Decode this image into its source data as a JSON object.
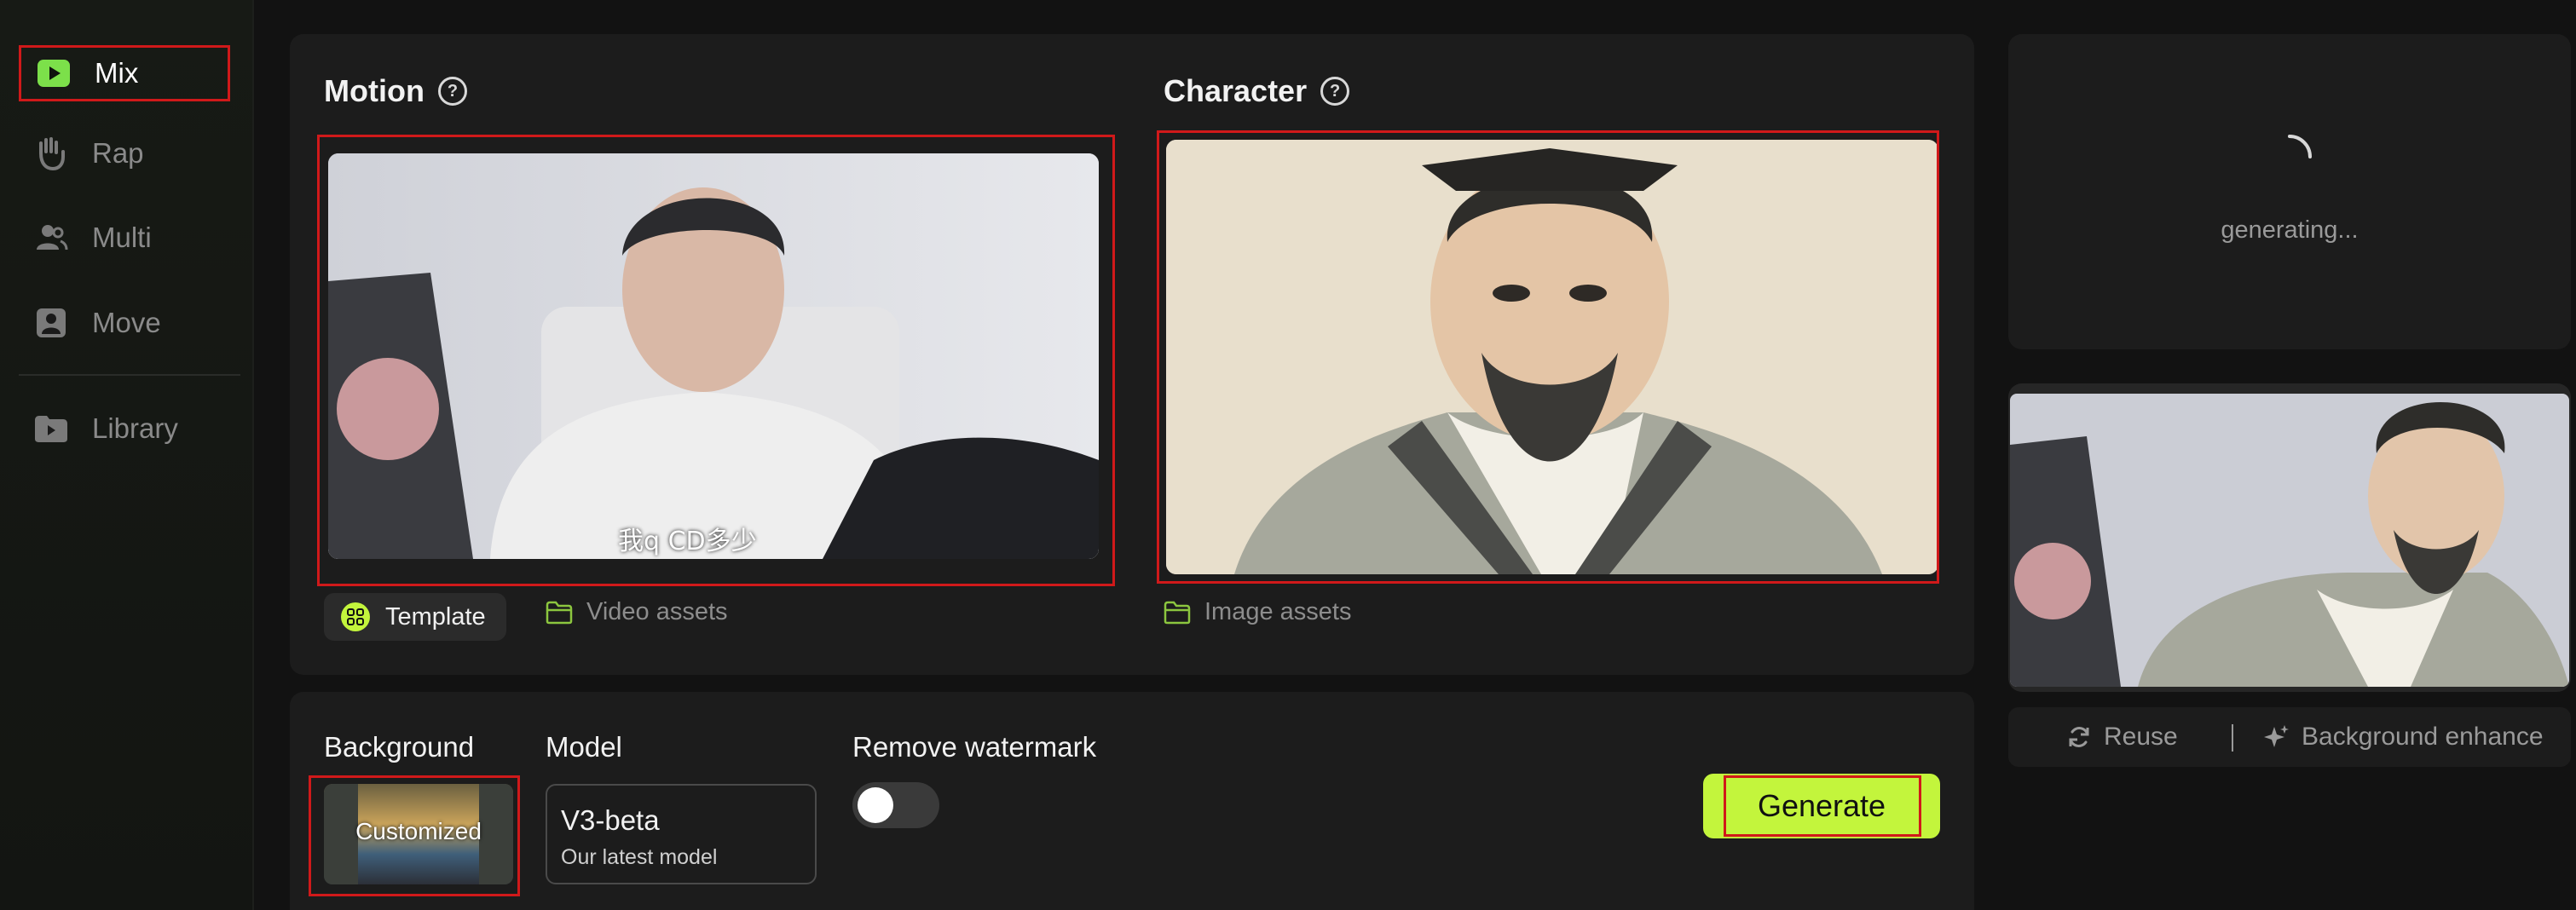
{
  "sidebar": {
    "items": [
      {
        "label": "Mix",
        "icon": "play-square-icon",
        "active": true
      },
      {
        "label": "Rap",
        "icon": "hand-icon"
      },
      {
        "label": "Multi",
        "icon": "users-icon"
      },
      {
        "label": "Move",
        "icon": "person-card-icon"
      },
      {
        "label": "Library",
        "icon": "folder-play-icon"
      }
    ]
  },
  "motion": {
    "title": "Motion",
    "video_caption": "我q CD多少",
    "template_label": "Template",
    "video_assets_label": "Video assets"
  },
  "character": {
    "title": "Character",
    "image_assets_label": "Image assets"
  },
  "settings": {
    "background_label": "Background",
    "background_thumb_label": "Customized",
    "model_label": "Model",
    "model_name": "V3-beta",
    "model_desc": "Our latest model",
    "watermark_label": "Remove watermark",
    "watermark_on": false,
    "generate_label": "Generate"
  },
  "results": {
    "status": "generating...",
    "reuse_label": "Reuse",
    "enhance_label": "Background enhance"
  },
  "colors": {
    "accent": "#c3f53c",
    "highlight_border": "#d0191a",
    "panel": "#1c1c1c",
    "background": "#121212"
  }
}
